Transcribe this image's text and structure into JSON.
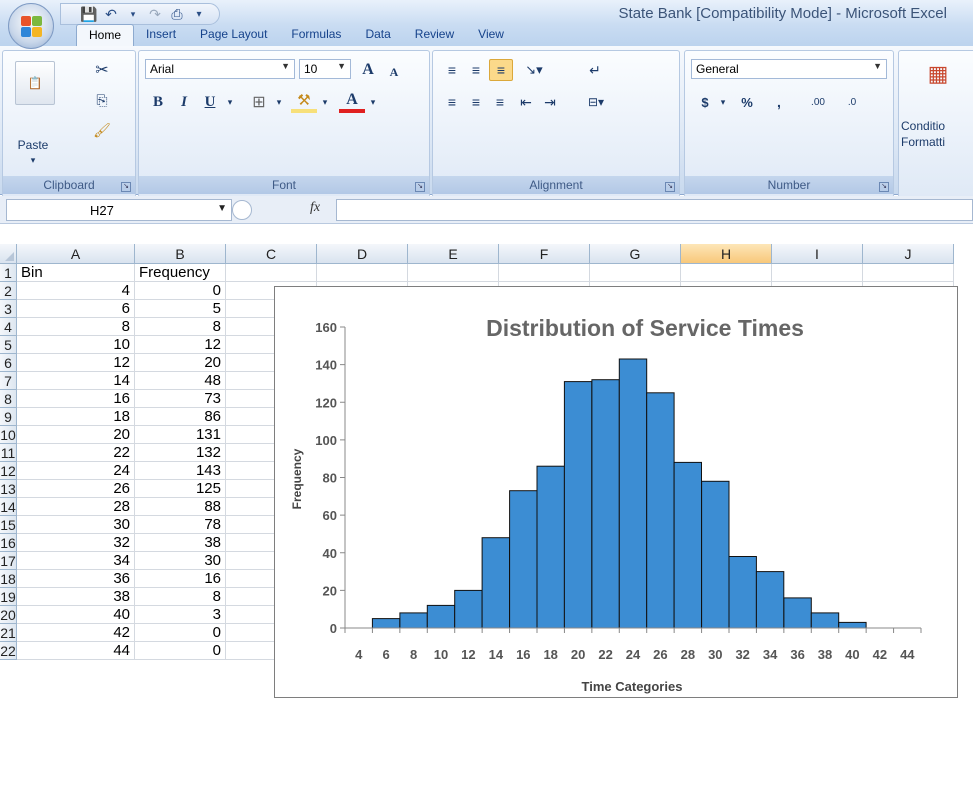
{
  "window": {
    "title": "State Bank  [Compatibility Mode] - Microsoft Excel"
  },
  "tabs": [
    "Home",
    "Insert",
    "Page Layout",
    "Formulas",
    "Data",
    "Review",
    "View"
  ],
  "ribbon": {
    "clipboard": {
      "paste": "Paste",
      "label": "Clipboard"
    },
    "font": {
      "name": "Arial",
      "size": "10",
      "bold": "B",
      "italic": "I",
      "underline": "U",
      "grow": "A",
      "shrink": "A",
      "font_color": "A",
      "label": "Font"
    },
    "alignment": {
      "label": "Alignment"
    },
    "number": {
      "format": "General",
      "currency": "$",
      "percent": "%",
      "comma": ",",
      "inc_decimal": ".00",
      "dec_decimal": ".0",
      "label": "Number"
    },
    "styles": {
      "conditional_line1": "Conditio",
      "conditional_line2": "Formatti"
    }
  },
  "formula_bar": {
    "name_box": "H27",
    "fx": "fx",
    "formula": ""
  },
  "columns": [
    "A",
    "B",
    "C",
    "D",
    "E",
    "F",
    "G",
    "H",
    "I",
    "J"
  ],
  "selected_column": "H",
  "rows": [
    {
      "n": "1",
      "a": "Bin",
      "b": "Frequency"
    },
    {
      "n": "2",
      "a": "4",
      "b": "0"
    },
    {
      "n": "3",
      "a": "6",
      "b": "5"
    },
    {
      "n": "4",
      "a": "8",
      "b": "8"
    },
    {
      "n": "5",
      "a": "10",
      "b": "12"
    },
    {
      "n": "6",
      "a": "12",
      "b": "20"
    },
    {
      "n": "7",
      "a": "14",
      "b": "48"
    },
    {
      "n": "8",
      "a": "16",
      "b": "73"
    },
    {
      "n": "9",
      "a": "18",
      "b": "86"
    },
    {
      "n": "10",
      "a": "20",
      "b": "131"
    },
    {
      "n": "11",
      "a": "22",
      "b": "132"
    },
    {
      "n": "12",
      "a": "24",
      "b": "143"
    },
    {
      "n": "13",
      "a": "26",
      "b": "125"
    },
    {
      "n": "14",
      "a": "28",
      "b": "88"
    },
    {
      "n": "15",
      "a": "30",
      "b": "78"
    },
    {
      "n": "16",
      "a": "32",
      "b": "38"
    },
    {
      "n": "17",
      "a": "34",
      "b": "30"
    },
    {
      "n": "18",
      "a": "36",
      "b": "16"
    },
    {
      "n": "19",
      "a": "38",
      "b": "8"
    },
    {
      "n": "20",
      "a": "40",
      "b": "3"
    },
    {
      "n": "21",
      "a": "42",
      "b": "0"
    },
    {
      "n": "22",
      "a": "44",
      "b": "0"
    }
  ],
  "chart_data": {
    "type": "bar",
    "title": "Distribution of Service Times",
    "xlabel": "Time Categories",
    "ylabel": "Frequency",
    "categories": [
      "4",
      "6",
      "8",
      "10",
      "12",
      "14",
      "16",
      "18",
      "20",
      "22",
      "24",
      "26",
      "28",
      "30",
      "32",
      "34",
      "36",
      "38",
      "40",
      "42",
      "44"
    ],
    "values": [
      0,
      5,
      8,
      12,
      20,
      48,
      73,
      86,
      131,
      132,
      143,
      125,
      88,
      78,
      38,
      30,
      16,
      8,
      3,
      0,
      0
    ],
    "ylim": [
      0,
      160
    ],
    "yticks": [
      "0",
      "20",
      "40",
      "60",
      "80",
      "100",
      "120",
      "140",
      "160"
    ],
    "bar_color": "#3c8dd3",
    "grid": false,
    "legend": "none"
  }
}
